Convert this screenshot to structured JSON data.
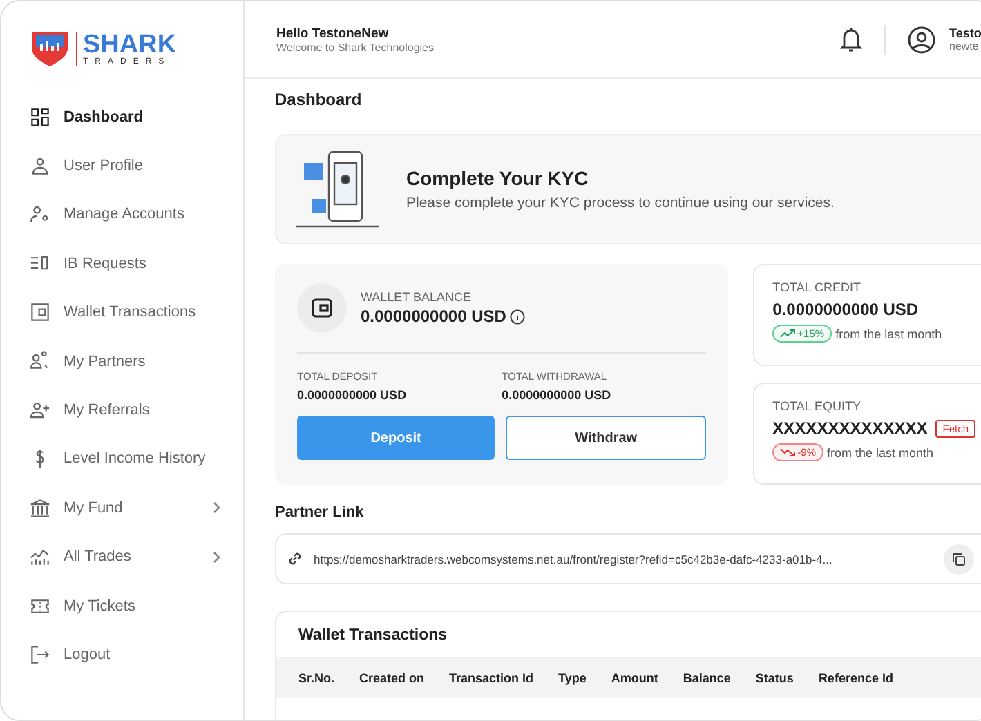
{
  "logo": {
    "name": "SHARK",
    "sub": "TRADERS"
  },
  "sidebar": {
    "items": [
      {
        "label": "Dashboard",
        "selected": true,
        "has_submenu": false
      },
      {
        "label": "User Profile",
        "selected": false,
        "has_submenu": false
      },
      {
        "label": "Manage Accounts",
        "selected": false,
        "has_submenu": false
      },
      {
        "label": "IB Requests",
        "selected": false,
        "has_submenu": false
      },
      {
        "label": "Wallet Transactions",
        "selected": false,
        "has_submenu": false
      },
      {
        "label": "My Partners",
        "selected": false,
        "has_submenu": false
      },
      {
        "label": "My Referrals",
        "selected": false,
        "has_submenu": false
      },
      {
        "label": "Level Income History",
        "selected": false,
        "has_submenu": false
      },
      {
        "label": "My Fund",
        "selected": false,
        "has_submenu": true
      },
      {
        "label": "All Trades",
        "selected": false,
        "has_submenu": true
      },
      {
        "label": "My Tickets",
        "selected": false,
        "has_submenu": false
      },
      {
        "label": "Logout",
        "selected": false,
        "has_submenu": false
      }
    ]
  },
  "header": {
    "greeting": "Hello TestoneNew",
    "subtitle": "Welcome to Shark Technologies",
    "user_name": "Testo",
    "user_email": "newte"
  },
  "page_title": "Dashboard",
  "kyc": {
    "title": "Complete Your KYC",
    "text": "Please complete your KYC process to continue using our services."
  },
  "wallet": {
    "label": "WALLET BALANCE",
    "value": "0.0000000000 USD",
    "deposit_label": "TOTAL DEPOSIT",
    "deposit_value": "0.0000000000 USD",
    "withdrawal_label": "TOTAL WITHDRAWAL",
    "withdrawal_value": "0.0000000000 USD",
    "buttons": [
      "Deposit",
      "Withdraw"
    ]
  },
  "stats": [
    {
      "label": "TOTAL CREDIT",
      "value": "0.0000000000 USD",
      "kind": "up",
      "change": "+15%",
      "note": "from the last month"
    },
    {
      "label": "TOTAL EQUITY",
      "value": "XXXXXXXXXXXXXX",
      "action": "Fetch",
      "kind": "down",
      "change": "-9%",
      "note": "from the last month"
    }
  ],
  "partner_link": {
    "title": "Partner Link",
    "url": "https://demosharktraders.webcomsystems.net.au/front/register?refid=c5c42b3e-dafc-4233-a01b-4..."
  },
  "transactions": {
    "title": "Wallet Transactions",
    "columns": [
      "Sr.No.",
      "Created on",
      "Transaction Id",
      "Type",
      "Amount",
      "Balance",
      "Status",
      "Reference Id"
    ]
  }
}
